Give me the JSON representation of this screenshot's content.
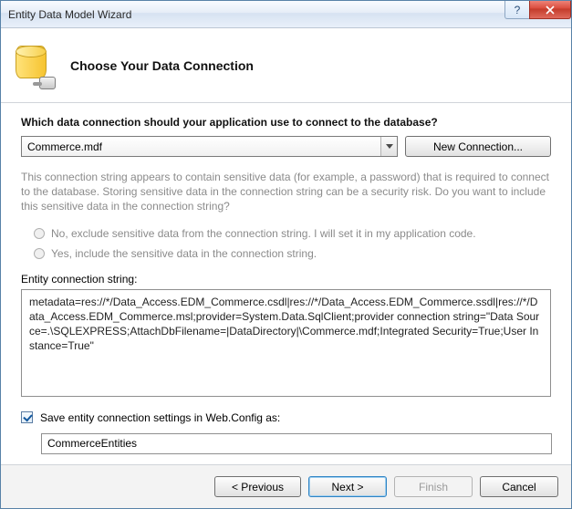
{
  "window": {
    "title": "Entity Data Model Wizard"
  },
  "header": {
    "title": "Choose Your Data Connection"
  },
  "question": "Which data connection should your application use to connect to the database?",
  "dropdown": {
    "selected": "Commerce.mdf"
  },
  "newConnBtn": "New Connection...",
  "infoText": "This connection string appears to contain sensitive data (for example, a password) that is required to connect to the database. Storing sensitive data in the connection string can be a security risk. Do you want to include this sensitive data in the connection string?",
  "radio1": "No, exclude sensitive data from the connection string. I will set it in my application code.",
  "radio2": "Yes, include the sensitive data in the connection string.",
  "connStringLabel": "Entity connection string:",
  "connString": "metadata=res://*/Data_Access.EDM_Commerce.csdl|res://*/Data_Access.EDM_Commerce.ssdl|res://*/Data_Access.EDM_Commerce.msl;provider=System.Data.SqlClient;provider connection string=\"Data Source=.\\SQLEXPRESS;AttachDbFilename=|DataDirectory|\\Commerce.mdf;Integrated Security=True;User Instance=True\"",
  "saveSettingsLabel": "Save entity connection settings in Web.Config as:",
  "entitiesName": "CommerceEntities",
  "buttons": {
    "previous": "< Previous",
    "next": "Next >",
    "finish": "Finish",
    "cancel": "Cancel"
  }
}
